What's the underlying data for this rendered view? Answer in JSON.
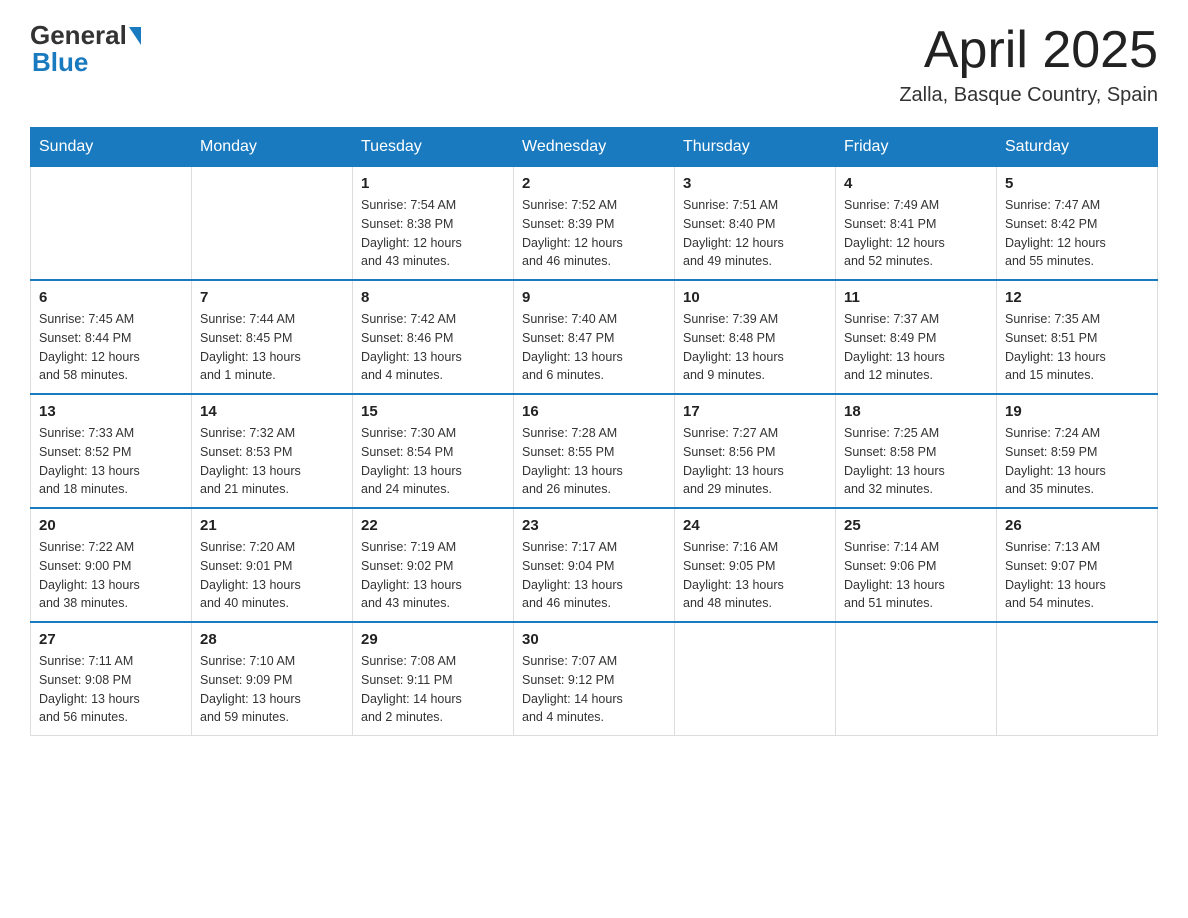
{
  "header": {
    "logo_general": "General",
    "logo_blue": "Blue",
    "month_title": "April 2025",
    "location": "Zalla, Basque Country, Spain"
  },
  "days_of_week": [
    "Sunday",
    "Monday",
    "Tuesday",
    "Wednesday",
    "Thursday",
    "Friday",
    "Saturday"
  ],
  "weeks": [
    [
      {
        "day": "",
        "info": ""
      },
      {
        "day": "",
        "info": ""
      },
      {
        "day": "1",
        "info": "Sunrise: 7:54 AM\nSunset: 8:38 PM\nDaylight: 12 hours\nand 43 minutes."
      },
      {
        "day": "2",
        "info": "Sunrise: 7:52 AM\nSunset: 8:39 PM\nDaylight: 12 hours\nand 46 minutes."
      },
      {
        "day": "3",
        "info": "Sunrise: 7:51 AM\nSunset: 8:40 PM\nDaylight: 12 hours\nand 49 minutes."
      },
      {
        "day": "4",
        "info": "Sunrise: 7:49 AM\nSunset: 8:41 PM\nDaylight: 12 hours\nand 52 minutes."
      },
      {
        "day": "5",
        "info": "Sunrise: 7:47 AM\nSunset: 8:42 PM\nDaylight: 12 hours\nand 55 minutes."
      }
    ],
    [
      {
        "day": "6",
        "info": "Sunrise: 7:45 AM\nSunset: 8:44 PM\nDaylight: 12 hours\nand 58 minutes."
      },
      {
        "day": "7",
        "info": "Sunrise: 7:44 AM\nSunset: 8:45 PM\nDaylight: 13 hours\nand 1 minute."
      },
      {
        "day": "8",
        "info": "Sunrise: 7:42 AM\nSunset: 8:46 PM\nDaylight: 13 hours\nand 4 minutes."
      },
      {
        "day": "9",
        "info": "Sunrise: 7:40 AM\nSunset: 8:47 PM\nDaylight: 13 hours\nand 6 minutes."
      },
      {
        "day": "10",
        "info": "Sunrise: 7:39 AM\nSunset: 8:48 PM\nDaylight: 13 hours\nand 9 minutes."
      },
      {
        "day": "11",
        "info": "Sunrise: 7:37 AM\nSunset: 8:49 PM\nDaylight: 13 hours\nand 12 minutes."
      },
      {
        "day": "12",
        "info": "Sunrise: 7:35 AM\nSunset: 8:51 PM\nDaylight: 13 hours\nand 15 minutes."
      }
    ],
    [
      {
        "day": "13",
        "info": "Sunrise: 7:33 AM\nSunset: 8:52 PM\nDaylight: 13 hours\nand 18 minutes."
      },
      {
        "day": "14",
        "info": "Sunrise: 7:32 AM\nSunset: 8:53 PM\nDaylight: 13 hours\nand 21 minutes."
      },
      {
        "day": "15",
        "info": "Sunrise: 7:30 AM\nSunset: 8:54 PM\nDaylight: 13 hours\nand 24 minutes."
      },
      {
        "day": "16",
        "info": "Sunrise: 7:28 AM\nSunset: 8:55 PM\nDaylight: 13 hours\nand 26 minutes."
      },
      {
        "day": "17",
        "info": "Sunrise: 7:27 AM\nSunset: 8:56 PM\nDaylight: 13 hours\nand 29 minutes."
      },
      {
        "day": "18",
        "info": "Sunrise: 7:25 AM\nSunset: 8:58 PM\nDaylight: 13 hours\nand 32 minutes."
      },
      {
        "day": "19",
        "info": "Sunrise: 7:24 AM\nSunset: 8:59 PM\nDaylight: 13 hours\nand 35 minutes."
      }
    ],
    [
      {
        "day": "20",
        "info": "Sunrise: 7:22 AM\nSunset: 9:00 PM\nDaylight: 13 hours\nand 38 minutes."
      },
      {
        "day": "21",
        "info": "Sunrise: 7:20 AM\nSunset: 9:01 PM\nDaylight: 13 hours\nand 40 minutes."
      },
      {
        "day": "22",
        "info": "Sunrise: 7:19 AM\nSunset: 9:02 PM\nDaylight: 13 hours\nand 43 minutes."
      },
      {
        "day": "23",
        "info": "Sunrise: 7:17 AM\nSunset: 9:04 PM\nDaylight: 13 hours\nand 46 minutes."
      },
      {
        "day": "24",
        "info": "Sunrise: 7:16 AM\nSunset: 9:05 PM\nDaylight: 13 hours\nand 48 minutes."
      },
      {
        "day": "25",
        "info": "Sunrise: 7:14 AM\nSunset: 9:06 PM\nDaylight: 13 hours\nand 51 minutes."
      },
      {
        "day": "26",
        "info": "Sunrise: 7:13 AM\nSunset: 9:07 PM\nDaylight: 13 hours\nand 54 minutes."
      }
    ],
    [
      {
        "day": "27",
        "info": "Sunrise: 7:11 AM\nSunset: 9:08 PM\nDaylight: 13 hours\nand 56 minutes."
      },
      {
        "day": "28",
        "info": "Sunrise: 7:10 AM\nSunset: 9:09 PM\nDaylight: 13 hours\nand 59 minutes."
      },
      {
        "day": "29",
        "info": "Sunrise: 7:08 AM\nSunset: 9:11 PM\nDaylight: 14 hours\nand 2 minutes."
      },
      {
        "day": "30",
        "info": "Sunrise: 7:07 AM\nSunset: 9:12 PM\nDaylight: 14 hours\nand 4 minutes."
      },
      {
        "day": "",
        "info": ""
      },
      {
        "day": "",
        "info": ""
      },
      {
        "day": "",
        "info": ""
      }
    ]
  ]
}
